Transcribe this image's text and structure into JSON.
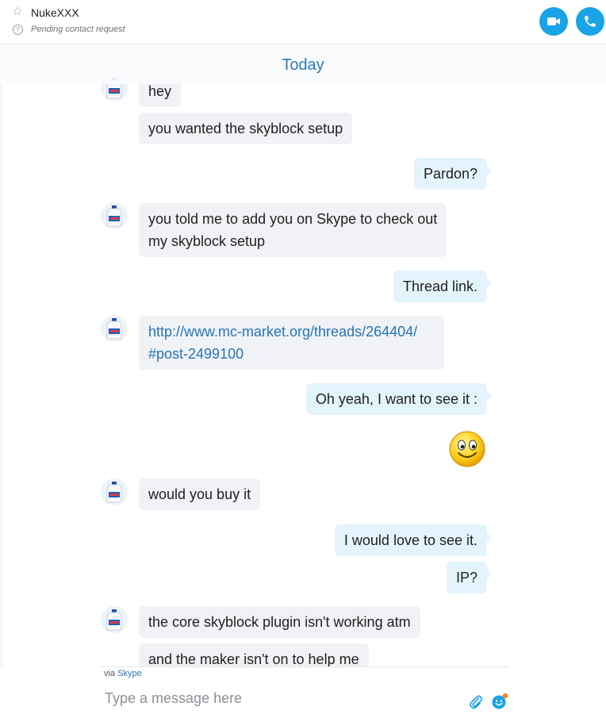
{
  "header": {
    "contact_name": "NukeXXX",
    "status_text": "Pending contact request",
    "accent_color": "#1aa3e6"
  },
  "chat": {
    "day_label": "Today",
    "messages": [
      {
        "dir": "in",
        "text": "hey"
      },
      {
        "dir": "in",
        "text": "you wanted the skyblock setup"
      },
      {
        "dir": "out",
        "text": "Pardon?"
      },
      {
        "dir": "in",
        "lines": [
          "you told me to add you on Skype to check out",
          "my skyblock setup"
        ]
      },
      {
        "dir": "out",
        "text": "Thread link."
      },
      {
        "dir": "in",
        "lines": [
          "http://www.mc-market.org/threads/264404/",
          "#post-2499100"
        ]
      },
      {
        "dir": "out",
        "text": "Oh yeah, I want to see it :"
      },
      {
        "dir": "out",
        "emoticon": "smile-emoticon"
      },
      {
        "dir": "in",
        "text": "would you buy it"
      },
      {
        "dir": "out",
        "text": "I would love to see it."
      },
      {
        "dir": "out",
        "text": "IP?"
      },
      {
        "dir": "in",
        "text": "the core skyblock plugin isn't working atm"
      },
      {
        "dir": "in",
        "text": "and the maker isn't on to help me"
      }
    ]
  },
  "footer": {
    "via_prefix": "via",
    "via_link": "Skype",
    "input_placeholder": "Type a message here",
    "input_value": ""
  }
}
